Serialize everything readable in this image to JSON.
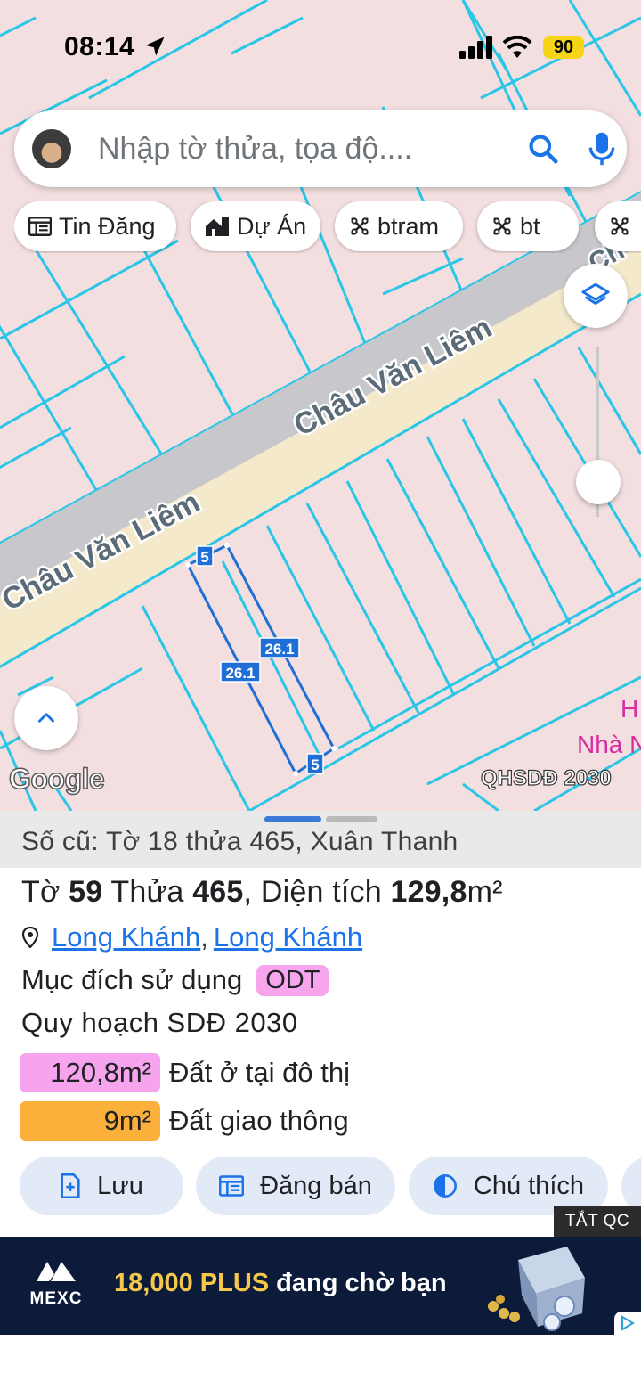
{
  "status": {
    "time": "08:14",
    "battery": "90"
  },
  "search": {
    "placeholder": "Nhập tờ thửa, tọa độ...."
  },
  "chips": [
    {
      "label": "Tin Đăng",
      "icon": "listing-icon"
    },
    {
      "label": "Dự Án",
      "icon": "building-icon"
    },
    {
      "label": "btram",
      "icon": "pattern-icon"
    },
    {
      "label": "bt",
      "icon": "pattern-icon"
    }
  ],
  "map": {
    "street_name_1": "Châu Văn Liêm",
    "street_name_2": "Châu Văn Liêm",
    "street_name_3": "Ch",
    "poi_label_1": "H",
    "poi_label_2": "Nhà N",
    "parcel_dim_top": "5",
    "parcel_dim_right": "26.1",
    "parcel_dim_left": "26.1",
    "parcel_dim_bottom": "5",
    "provider": "Google",
    "layer_label": "QHSDĐ 2030",
    "colors": {
      "parcel_line": "#29c6e8",
      "road": "#f5e9cc",
      "road_edge": "#c4c3c8",
      "selected": "#1f6fd6",
      "background": "#f3dfe0"
    }
  },
  "sheet": {
    "old_parcel": "Số cũ: Tờ 18 thửa 465, Xuân Thanh",
    "title": {
      "sheet_label": "Tờ",
      "sheet_no": "59",
      "parcel_label": "Thửa",
      "parcel_no": "465",
      "area_label": ", Diện tích",
      "area_value": "129,8",
      "area_unit": "m²"
    },
    "location": {
      "district": "Long Khánh",
      "city": "Long Khánh"
    },
    "usage_label": "Mục đích sử dụng",
    "usage_code": "ODT",
    "plan_label": "Quy hoạch SDĐ 2030",
    "areas": [
      {
        "value": "120,8m²",
        "desc": "Đất ở tại đô thị",
        "color": "#f6a4ee"
      },
      {
        "value": "9m²",
        "desc": "Đất giao thông",
        "color": "#fbb03b"
      }
    ],
    "actions": [
      {
        "label": "Lưu",
        "icon": "save-add-icon"
      },
      {
        "label": "Đăng bán",
        "icon": "listing-icon"
      },
      {
        "label": "Chú thích",
        "icon": "contrast-icon"
      }
    ]
  },
  "ad": {
    "close_label": "TẮT QC",
    "brand": "MEXC",
    "text_highlight": "18,000 PLUS",
    "text_rest": " đang chờ bạn"
  }
}
